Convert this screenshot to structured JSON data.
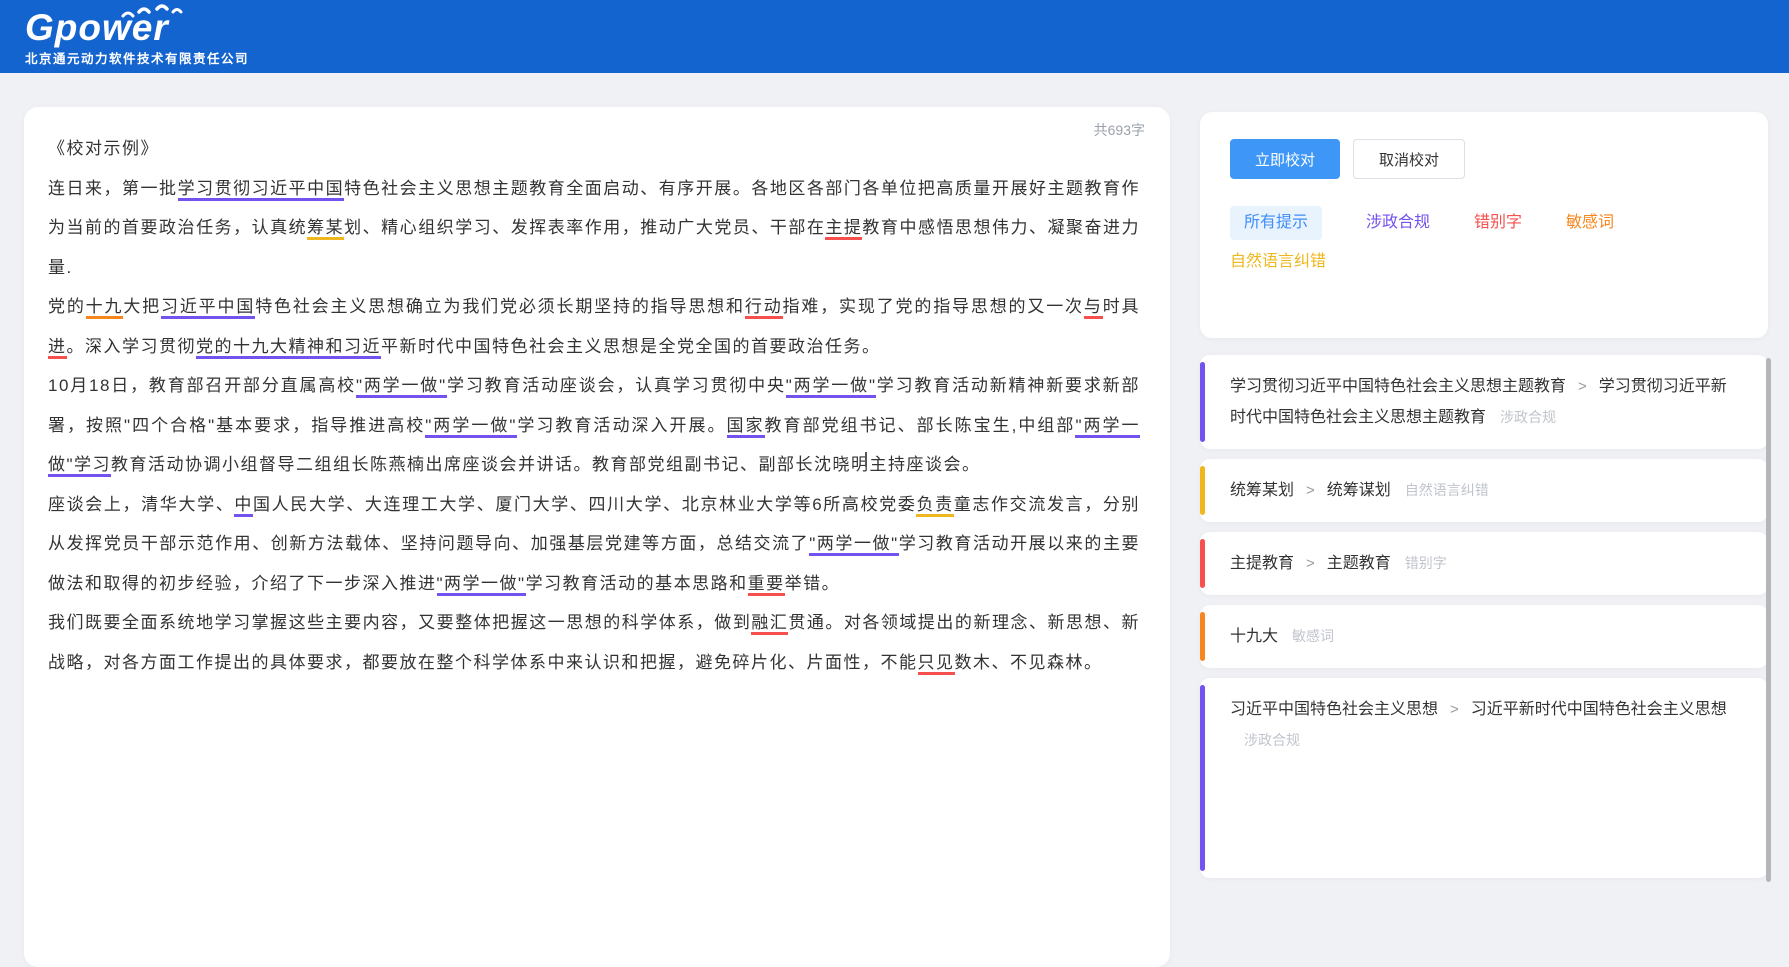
{
  "header": {
    "logo": "Gpower",
    "company": "北京通元动力软件技术有限责任公司"
  },
  "document": {
    "word_count": "共693字",
    "title": "《校对示例》",
    "paragraphs": [
      [
        {
          "t": "连日来，第一批"
        },
        {
          "t": "学习贯彻习近平中国",
          "m": "politics"
        },
        {
          "t": "特色社会主义思想主题教育全面启动、有序开展。各地区各部门各单位把高质量开展好主题教育作为当前的首要政治任务，认真统"
        },
        {
          "t": "筹某",
          "m": "nlp"
        },
        {
          "t": "划、精心组织学习、发挥表率作用，推动广大党员、干部在"
        },
        {
          "t": "主提",
          "m": "typo"
        },
        {
          "t": "教育中感悟思想伟力、凝聚奋进力量."
        }
      ],
      [
        {
          "t": "党的"
        },
        {
          "t": "十九",
          "m": "sensitive"
        },
        {
          "t": "大把"
        },
        {
          "t": "习近平中国",
          "m": "politics"
        },
        {
          "t": "特色社会主义思想确立为我们党必须长期坚持的指导思想和"
        },
        {
          "t": "行动",
          "m": "typo"
        },
        {
          "t": "指难，实现了党的指导思想的又一次"
        },
        {
          "t": "与",
          "m": "typo"
        },
        {
          "t": "时具"
        },
        {
          "t": "进",
          "m": "typo"
        },
        {
          "t": "。深入学习贯彻"
        },
        {
          "t": "党的十九大精神和习近",
          "m": "politics"
        },
        {
          "t": "平新时代中国特色社会主义思想是全党全国的首要政治任务。"
        }
      ],
      [
        {
          "t": "10月18日，教育部召开部分直属高校"
        },
        {
          "t": "\"两学一做\"",
          "m": "politics"
        },
        {
          "t": "学习教育活动座谈会，认真学习贯彻中央"
        },
        {
          "t": "\"两学一做\"",
          "m": "politics"
        },
        {
          "t": "学习教育活动新精神新要求新部署，按照\"四个合格\"基本要求，指导推进高校"
        },
        {
          "t": "\"两学一做\"",
          "m": "politics"
        },
        {
          "t": "学习教育活动深入开展。"
        },
        {
          "t": "国家",
          "m": "politics"
        },
        {
          "t": "教育部党组书记、部长陈宝生,中组部"
        },
        {
          "t": "\"两学一做\"学习",
          "m": "politics"
        },
        {
          "t": "教育活动协调小组督导二组组长陈燕楠出席座谈会并讲话。教育部党组副书记、副部长沈晓明主持座谈会。"
        }
      ],
      [
        {
          "t": "座谈会上，清华大学、"
        },
        {
          "t": "中",
          "m": "politics"
        },
        {
          "t": "国人民大学、大连理工大学、厦门大学、四川大学、北京林业大学等6所高校党委"
        },
        {
          "t": "负责",
          "m": "nlp"
        },
        {
          "t": "童志作交流发言，分别从发挥党员干部示范作用、创新方法载体、坚持问题导向、加强基层党建等方面，总结交流了"
        },
        {
          "t": "\"两学一做\"",
          "m": "politics"
        },
        {
          "t": "学习教育活动开展以来的主要做法和取得的初步经验，介绍了下一步深入推进"
        },
        {
          "t": "\"两学一做\"",
          "m": "politics"
        },
        {
          "t": "学习教育活动的基本思路和"
        },
        {
          "t": "重要",
          "m": "typo"
        },
        {
          "t": "举错。"
        }
      ],
      [
        {
          "t": "我们既要全面系统地学习掌握这些主要内容，又要整体把握这一思想的科学体系，做到"
        },
        {
          "t": "融汇",
          "m": "typo"
        },
        {
          "t": "贯通。对各领域提出的新理念、新思想、新战略，对各方面工作提出的具体要求，都要放在整个科学体系中来认识和把握，避免碎片化、片面性，不能"
        },
        {
          "t": "只见",
          "m": "typo"
        },
        {
          "t": "数木、不见森林。"
        }
      ]
    ]
  },
  "panel": {
    "proofread_button": "立即校对",
    "cancel_button": "取消校对",
    "filters": [
      {
        "label": "所有提示",
        "type": "all",
        "active": true
      },
      {
        "label": "涉政合规",
        "type": "politics",
        "active": false
      },
      {
        "label": "错别字",
        "type": "typo",
        "active": false
      },
      {
        "label": "敏感词",
        "type": "sensitive",
        "active": false
      },
      {
        "label": "自然语言纠错",
        "type": "nlp",
        "active": false
      }
    ],
    "corrections": [
      {
        "original": "学习贯彻习近平中国特色社会主义思想主题教育",
        "suggestion": "学习贯彻习近平新时代中国特色社会主义思想主题教育",
        "category": "涉政合规",
        "type": "politics"
      },
      {
        "original": "统筹某划",
        "suggestion": "统筹谋划",
        "category": "自然语言纠错",
        "type": "nlp"
      },
      {
        "original": "主提教育",
        "suggestion": "主题教育",
        "category": "错别字",
        "type": "typo"
      },
      {
        "original": "十九大",
        "suggestion": "",
        "category": "敏感词",
        "type": "sensitive"
      },
      {
        "original": "习近平中国特色社会主义思想",
        "suggestion": "习近平新时代中国特色社会主义思想",
        "category": "涉政合规",
        "type": "politics"
      }
    ]
  },
  "colors": {
    "politics": "#7452EF",
    "nlp": "#EFB71E",
    "typo": "#F6504E",
    "sensitive": "#F8861E",
    "filter_active": "#3E8EF7",
    "filter_active_bg": "#E9F3FE",
    "primary_button": "#3E97F7",
    "header_bg": "#1464CF"
  }
}
